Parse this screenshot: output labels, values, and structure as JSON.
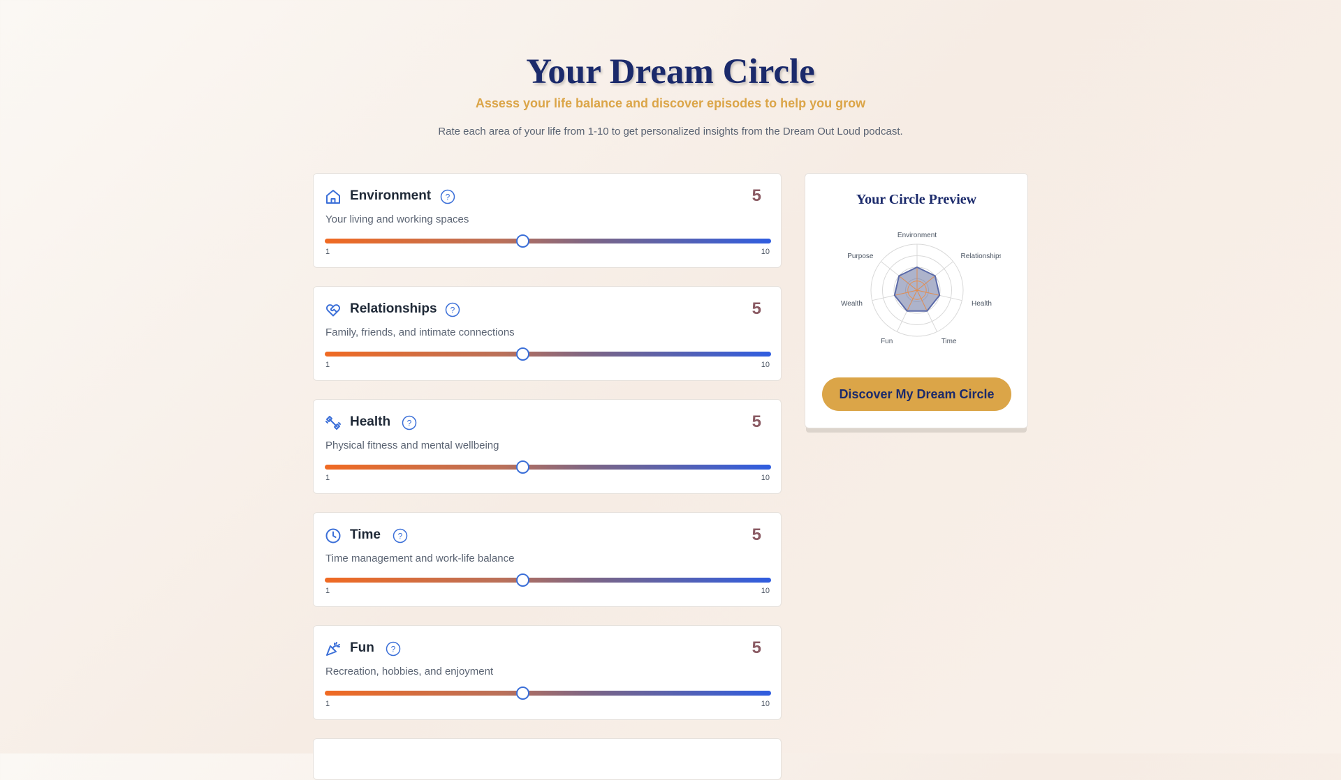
{
  "header": {
    "title": "Your Dream Circle",
    "subtitle": "Assess your life balance and discover episodes to help you grow",
    "intro": "Rate each area of your life from 1-10 to get personalized insights from the Dream Out Loud podcast."
  },
  "slider_range": {
    "min": 1,
    "max": 10,
    "min_label": "1",
    "max_label": "10"
  },
  "categories": [
    {
      "name": "Environment",
      "description": "Your living and working spaces",
      "value": 5,
      "score_label": "5",
      "icon": "home-icon"
    },
    {
      "name": "Relationships",
      "description": "Family, friends, and intimate connections",
      "value": 5,
      "score_label": "5",
      "icon": "heart-handshake-icon"
    },
    {
      "name": "Health",
      "description": "Physical fitness and mental wellbeing",
      "value": 5,
      "score_label": "5",
      "icon": "dumbbell-icon"
    },
    {
      "name": "Time",
      "description": "Time management and work-life balance",
      "value": 5,
      "score_label": "5",
      "icon": "clock-icon"
    },
    {
      "name": "Fun",
      "description": "Recreation, hobbies, and enjoyment",
      "value": 5,
      "score_label": "5",
      "icon": "party-popper-icon"
    }
  ],
  "preview": {
    "title": "Your Circle Preview",
    "button_label": "Discover My Dream Circle",
    "axes": [
      "Environment",
      "Relationships",
      "Health",
      "Time",
      "Fun",
      "Wealth",
      "Purpose"
    ],
    "values": [
      5,
      5,
      5,
      5,
      5,
      5,
      5
    ],
    "max": 10
  },
  "colors": {
    "navy": "#1b2a6b",
    "gold": "#dba548",
    "score": "#8a5a63",
    "icon_blue": "#3b6fd8",
    "slider_start": "#f06a22",
    "slider_end": "#2f5de0"
  }
}
